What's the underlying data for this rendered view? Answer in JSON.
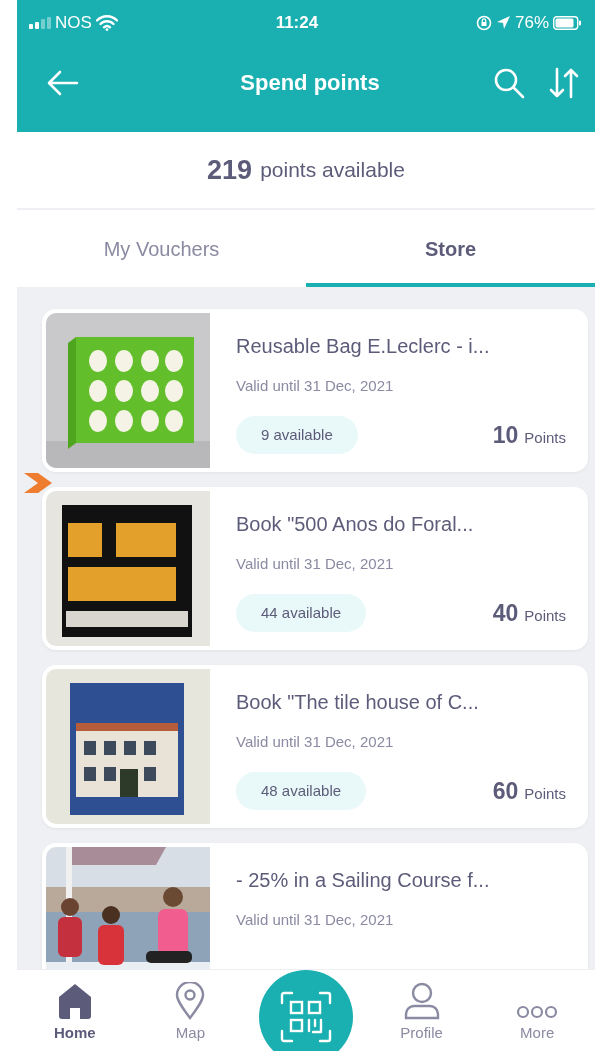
{
  "status_bar": {
    "carrier": "NOS",
    "time": "11:24",
    "battery": "76%"
  },
  "header": {
    "title": "Spend points"
  },
  "balance": {
    "value": "219",
    "label": "points available"
  },
  "tabs": [
    {
      "label": "My Vouchers",
      "selected": false
    },
    {
      "label": "Store",
      "selected": true
    }
  ],
  "vouchers": [
    {
      "title": "Reusable Bag E.Leclerc - i...",
      "valid": "Valid until 31 Dec, 2021",
      "available": "9 available",
      "points": "10",
      "points_unit": "Points"
    },
    {
      "title": "Book \"500 Anos do Foral...",
      "valid": "Valid until 31 Dec, 2021",
      "available": "44 available",
      "points": "40",
      "points_unit": "Points"
    },
    {
      "title": "Book \"The tile house of C...",
      "valid": "Valid until 31 Dec, 2021",
      "available": "48 available",
      "points": "60",
      "points_unit": "Points"
    },
    {
      "title": "- 25% in a Sailing Course f...",
      "valid": "Valid until 31 Dec, 2021"
    }
  ],
  "bottom_nav": [
    {
      "kind": "home",
      "label": "Home",
      "selected": true
    },
    {
      "kind": "map",
      "label": "Map",
      "selected": false
    },
    {
      "kind": "scan"
    },
    {
      "kind": "profile",
      "label": "Profile",
      "selected": false
    },
    {
      "kind": "more",
      "label": "More",
      "selected": false
    }
  ]
}
